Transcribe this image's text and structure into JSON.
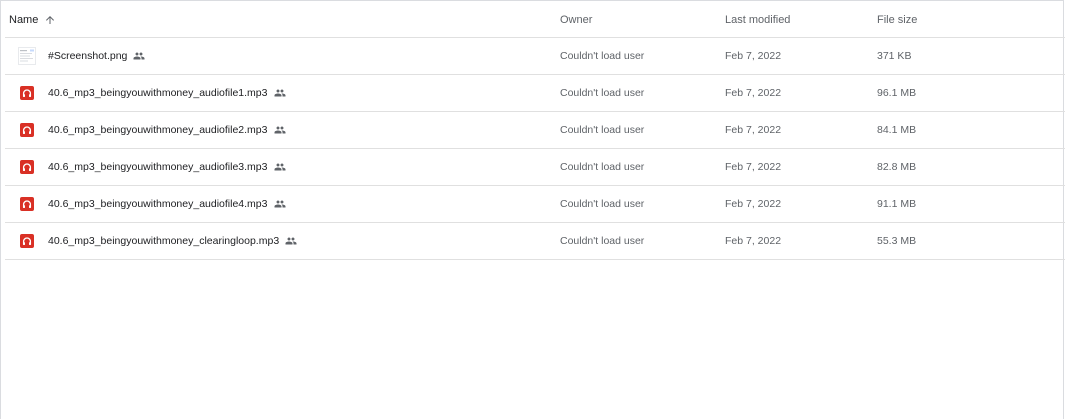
{
  "header": {
    "name_label": "Name",
    "owner_label": "Owner",
    "modified_label": "Last modified",
    "size_label": "File size",
    "sort_direction": "ascending",
    "sort_icon": "arrow-up-icon"
  },
  "colors": {
    "audio_icon": "#d93025",
    "divider": "#e0e0e0",
    "text_primary": "#202124",
    "text_secondary": "#5f6368"
  },
  "files": [
    {
      "name": "#Screenshot.png",
      "type_icon": "image-thumbnail-icon",
      "shared": true,
      "owner": "Couldn't load user",
      "modified": "Feb 7, 2022",
      "size": "371 KB"
    },
    {
      "name": "40.6_mp3_beingyouwithmoney_audiofile1.mp3",
      "type_icon": "audio-file-icon",
      "shared": true,
      "owner": "Couldn't load user",
      "modified": "Feb 7, 2022",
      "size": "96.1 MB"
    },
    {
      "name": "40.6_mp3_beingyouwithmoney_audiofile2.mp3",
      "type_icon": "audio-file-icon",
      "shared": true,
      "owner": "Couldn't load user",
      "modified": "Feb 7, 2022",
      "size": "84.1 MB"
    },
    {
      "name": "40.6_mp3_beingyouwithmoney_audiofile3.mp3",
      "type_icon": "audio-file-icon",
      "shared": true,
      "owner": "Couldn't load user",
      "modified": "Feb 7, 2022",
      "size": "82.8 MB"
    },
    {
      "name": "40.6_mp3_beingyouwithmoney_audiofile4.mp3",
      "type_icon": "audio-file-icon",
      "shared": true,
      "owner": "Couldn't load user",
      "modified": "Feb 7, 2022",
      "size": "91.1 MB"
    },
    {
      "name": "40.6_mp3_beingyouwithmoney_clearingloop.mp3",
      "type_icon": "audio-file-icon",
      "shared": true,
      "owner": "Couldn't load user",
      "modified": "Feb 7, 2022",
      "size": "55.3 MB"
    }
  ]
}
